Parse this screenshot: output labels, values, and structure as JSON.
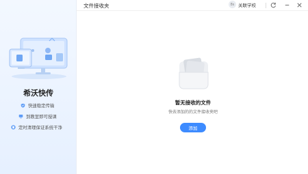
{
  "sidebar": {
    "brand": "希沃快传",
    "features": [
      {
        "icon": "shield-check-icon",
        "label": "快速稳定传输"
      },
      {
        "icon": "monitor-icon",
        "label": "到教室即可授课"
      },
      {
        "icon": "trash-clean-icon",
        "label": "定时清理保证系统干净"
      }
    ]
  },
  "header": {
    "title": "文件接收夹",
    "avatar_text": "8s",
    "school": "关联学校"
  },
  "empty_state": {
    "title": "暂无接收的文件",
    "subtitle": "快去添加的的文件接收夹吧",
    "add_label": "添加"
  },
  "colors": {
    "accent": "#3d8bff",
    "sidebar_bg": "#e6f0ff"
  }
}
